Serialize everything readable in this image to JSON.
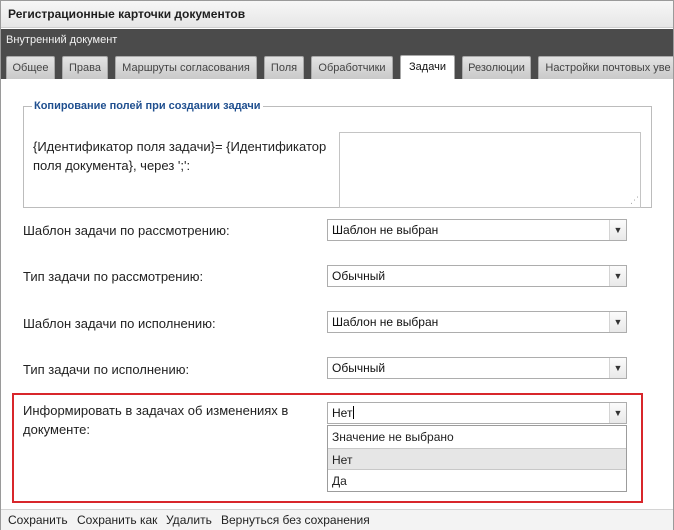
{
  "window": {
    "title": "Регистрационные карточки документов"
  },
  "document_type": "Внутренний документ",
  "tabs": [
    {
      "label": "Общее"
    },
    {
      "label": "Права"
    },
    {
      "label": "Маршруты согласования"
    },
    {
      "label": "Поля"
    },
    {
      "label": "Обработчики"
    },
    {
      "label": "Задачи",
      "active": true
    },
    {
      "label": "Резолюции"
    },
    {
      "label": "Настройки почтовых уве"
    }
  ],
  "copy_fields": {
    "legend": "Копирование полей при создании задачи",
    "label": "{Идентификатор поля задачи}= {Идентификатор поля документа}, через ';':",
    "textarea_value": ""
  },
  "fields": {
    "review_template": {
      "label": "Шаблон задачи по рассмотрению:",
      "value": "Шаблон не выбран"
    },
    "review_type": {
      "label": "Тип задачи по рассмотрению:",
      "value": "Обычный"
    },
    "exec_template": {
      "label": "Шаблон задачи по исполнению:",
      "value": "Шаблон не выбран"
    },
    "exec_type": {
      "label": "Тип задачи по исполнению:",
      "value": "Обычный"
    },
    "inform_changes": {
      "label": "Информировать в задачах об изменениях в документе:",
      "value": "Нет",
      "options": [
        "Значение не выбрано",
        "Нет",
        "Да"
      ]
    }
  },
  "footer": {
    "save": "Сохранить",
    "save_as": "Сохранить как",
    "delete": "Удалить",
    "back": "Вернуться без сохранения"
  },
  "icons": {
    "dropdown_arrow": "▼",
    "resize_grip": "⋰"
  },
  "colors": {
    "highlight_border": "#d8262b",
    "legend_text": "#1f4f8f",
    "tab_bar": "#4b4b4b"
  }
}
